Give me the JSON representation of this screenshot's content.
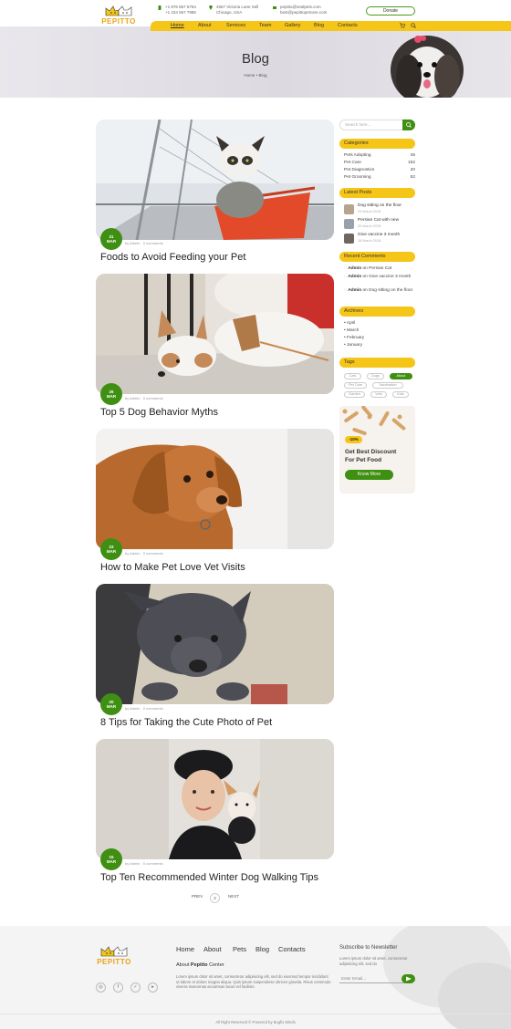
{
  "brand": {
    "name": "PEPITTO",
    "accent": "#f5c518",
    "green": "#3f8f12"
  },
  "topbar": {
    "phone1": "+1 876 867 5764",
    "phone2": "+1 234 567 7986",
    "address1": "4567 Victoria Lane Sell",
    "address2": "Chicago, USA",
    "email1": "pepitto@sealpets.com",
    "email2": "best@pepittopetcare.com",
    "donate_label": "Donate"
  },
  "nav": {
    "items": [
      "Home",
      "About",
      "Services",
      "Team",
      "Gallery",
      "Blog",
      "Contacts"
    ],
    "active": "Home",
    "cart_icon": "cart-icon",
    "search_icon": "search-icon"
  },
  "hero": {
    "title": "Blog",
    "breadcrumb_home": "Home",
    "breadcrumb_sep": "•",
    "breadcrumb_current": "Blog"
  },
  "posts": [
    {
      "day": "31",
      "month": "MAR",
      "author": "by Admin",
      "comments": "0 comments",
      "title": "Foods to Avoid Feeding your Pet"
    },
    {
      "day": "26",
      "month": "MAR",
      "author": "by Admin",
      "comments": "0 comments",
      "title": "Top 5 Dog Behavior Myths"
    },
    {
      "day": "23",
      "month": "MAR",
      "author": "by Admin",
      "comments": "0 comments",
      "title": "How to Make Pet Love Vet Visits"
    },
    {
      "day": "20",
      "month": "MAR",
      "author": "by Admin",
      "comments": "0 comments",
      "title": "8 Tips for Taking the Cute Photo of Pet"
    },
    {
      "day": "15",
      "month": "MAR",
      "author": "by Admin",
      "comments": "0 comments",
      "title": "Top Ten Recommended Winter Dog Walking Tips"
    }
  ],
  "pagination": {
    "prev": "PREV",
    "current": "2",
    "next": "NEXT"
  },
  "sidebar": {
    "search_placeholder": "Search here...",
    "categories_title": "Categories",
    "categories": [
      {
        "name": "Pets Adopting",
        "count": "45"
      },
      {
        "name": "Pet Care",
        "count": "152"
      },
      {
        "name": "Pet Diagnostics",
        "count": "20"
      },
      {
        "name": "Pet Grooming",
        "count": "52"
      }
    ],
    "latest_title": "Latest Posts",
    "latest": [
      {
        "title": "Dog sitting on the floor",
        "date": "23 March 2018"
      },
      {
        "title": "Persian Cat with new",
        "date": "20 March 2018"
      },
      {
        "title": "Give vaccine 3 month",
        "date": "18 March 2018"
      }
    ],
    "comments_title": "Recent Comments",
    "comments": [
      {
        "author": "Admin",
        "on": "on",
        "post": "Persian Cat"
      },
      {
        "author": "Admin",
        "on": "on",
        "post": "Give vaccine 3 month"
      },
      {
        "author": "Admin",
        "on": "on",
        "post": "Dog sitting on the floor"
      }
    ],
    "archives_title": "Archives",
    "archives": [
      "April",
      "March",
      "February",
      "January"
    ],
    "tags_title": "Tags",
    "tags": [
      "Cats",
      "Dogs",
      "About",
      "Pet Care",
      "Vaccination",
      "Garden",
      "Vets",
      "Kids"
    ],
    "active_tag": "About",
    "promo": {
      "badge": "-10%",
      "title_line1": "Get Best Discount",
      "title_line2": "For Pet Food",
      "button": "Know More"
    }
  },
  "footer": {
    "nav": [
      "Home",
      "About",
      "Pets",
      "Blog",
      "Contacts"
    ],
    "about_prefix": "About ",
    "about_brand": "Pepitto",
    "about_suffix": " Center",
    "about_text": "Lorem ipsum dolor sit amet, consectetur adipisicing elit, sed do eiusmod tempor incididunt ut labore et dolore magna aliqua. Quis ipsum suspendisse ultrices gravida. Risus commodo viverra maecenas accumsan lacus vel facilisis.",
    "social": [
      "instagram-icon",
      "facebook-icon",
      "twitter-icon",
      "youtube-icon"
    ],
    "newsletter_title": "Subscribe to Newsletter",
    "newsletter_text": "Lorem ipsum dolor sit amet, consectetur adipisicing elit, sed do",
    "newsletter_placeholder": "Enter Email...",
    "copyright": "All Right Reserved © Powered by Bugfix Minds"
  }
}
